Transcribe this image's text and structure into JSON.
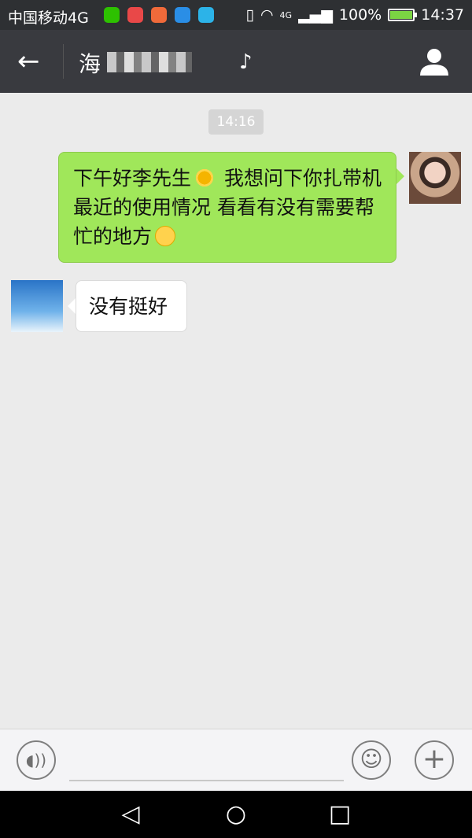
{
  "status_bar": {
    "carrier": "中国移动4G",
    "network": "4G",
    "battery_percent": "100%",
    "battery_level": 1.0,
    "time": "14:37",
    "app_icons": [
      "wechat-icon",
      "mail-icon",
      "phone-missed-icon",
      "gallery-icon",
      "message-icon"
    ],
    "app_icon_colors": [
      "#2dc100",
      "#e94848",
      "#f06a3a",
      "#2a8ee6",
      "#2cb3e8"
    ]
  },
  "header": {
    "title_visible": "海",
    "back_icon": "arrow-left-icon",
    "mode_icon": "earpiece-icon",
    "profile_icon": "person-icon"
  },
  "chat": {
    "timestamp": "14:16",
    "messages": [
      {
        "sender": "me",
        "parts": [
          "下午好李先生",
          "我想问下你扎带机最近的使用情况 看看有没有需要帮忙的地方"
        ],
        "emojis": [
          "sun-emoji",
          "smile-emoji"
        ]
      },
      {
        "sender": "other",
        "text": "没有挺好"
      }
    ]
  },
  "input_bar": {
    "placeholder": "",
    "voice_icon": "voice-icon",
    "emoji_icon": "emoji-icon",
    "plus_icon": "plus-icon"
  },
  "colors": {
    "titlebar": "#393a3f",
    "bubble_me": "#a0e75a",
    "bubble_other": "#ffffff",
    "chat_bg": "#ebebeb"
  }
}
